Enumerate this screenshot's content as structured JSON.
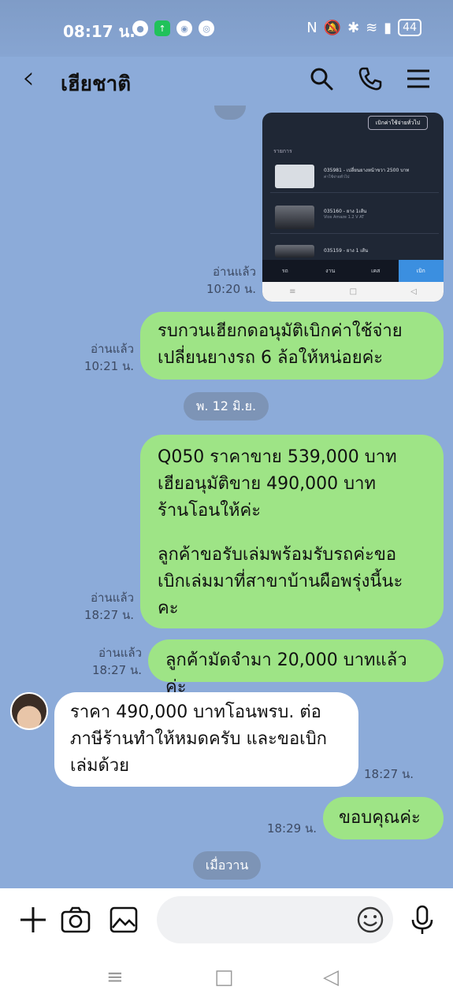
{
  "status_bar": {
    "time": "08:17 น.",
    "battery": "44"
  },
  "header": {
    "title": "เฮียชาติ"
  },
  "screenshot_message": {
    "button": "เบิกค่าใช้จ่ายทั่วไป",
    "section": "รายการ",
    "items": [
      {
        "title": "035981 - เปลี่ยนยางหน้าขวา 2500 บาท",
        "sub": "ค่าใช้จ่ายทั่วไป"
      },
      {
        "title": "035160 - ยาง 1เส้น",
        "sub": "Vios Amaze 1.2 V AT"
      },
      {
        "title": "035159 - ยาง 1 เส้น",
        "sub": ""
      }
    ],
    "tabs": [
      "รถ",
      "งาน",
      "เคส",
      "เบิก"
    ],
    "read": "อ่านแล้ว",
    "time": "10:20 น."
  },
  "messages": {
    "m1": {
      "line1": "รบกวนเฮียกดอนุมัติเบิกค่าใช้จ่าย",
      "line2": "เปลี่ยนยางรถ 6 ล้อให้หน่อยค่ะ",
      "read": "อ่านแล้ว",
      "time": "10:21 น."
    },
    "date_chip_1": "พ. 12 มิ.ย.",
    "m2": {
      "line1": "Q050 ราคาขาย 539,000 บาท",
      "line2": "เฮียอนุมัติขาย 490,000 บาท",
      "line3": "ร้านโอนให้ค่ะ",
      "line4": "ลูกค้าขอรับเล่มพร้อมรับรถค่ะขอ",
      "line5": "เบิกเล่มมาที่สาขาบ้านผือพรุ่งนี้นะ",
      "line6": "คะ",
      "read": "อ่านแล้ว",
      "time": "18:27 น."
    },
    "m3": {
      "text": "ลูกค้ามัดจำมา 20,000 บาทแล้วค่ะ",
      "read": "อ่านแล้ว",
      "time": "18:27 น."
    },
    "m4": {
      "line1": "ราคา 490,000 บาทโอนพรบ. ต่อ",
      "line2": "ภาษีร้านทำให้หมดครับ และขอเบิก",
      "line3": "เล่มด้วย",
      "time": "18:27 น."
    },
    "m5": {
      "text": "ขอบคุณค่ะ",
      "time": "18:29 น."
    },
    "date_chip_2": "เมื่อวาน"
  },
  "input": {
    "placeholder": ""
  }
}
